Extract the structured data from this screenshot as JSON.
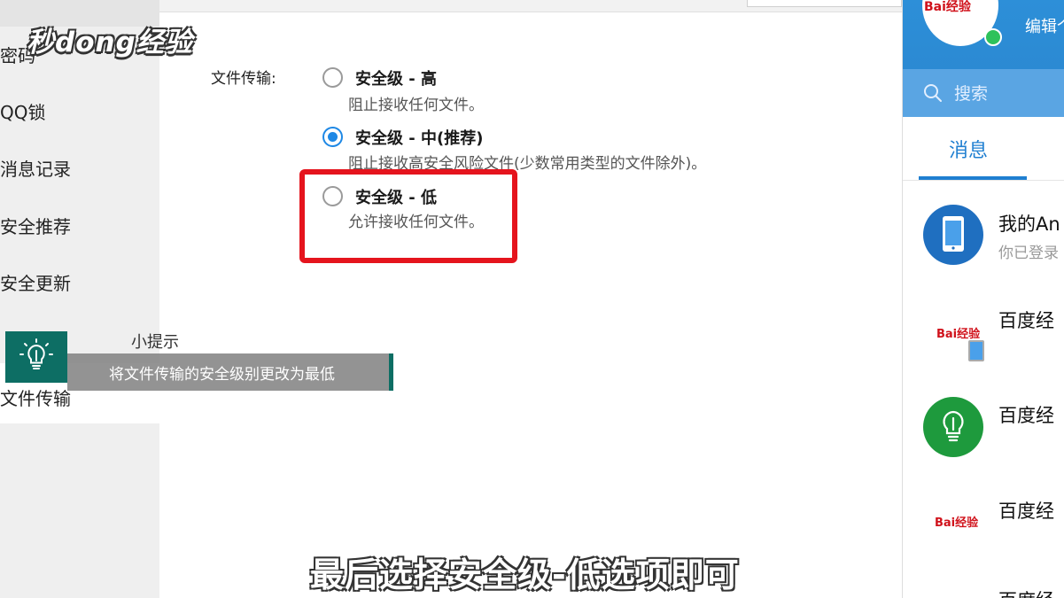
{
  "watermark": {
    "logo": "秒dong经验"
  },
  "sidebar": {
    "items": [
      {
        "label": "密码"
      },
      {
        "label": "QQ锁"
      },
      {
        "label": "消息记录"
      },
      {
        "label": "安全推荐"
      },
      {
        "label": "安全更新"
      },
      {
        "label": "文件传输"
      }
    ]
  },
  "file_transfer": {
    "label": "文件传输:",
    "options": [
      {
        "title": "安全级 - 高",
        "desc": "阻止接收任何文件。",
        "selected": false
      },
      {
        "title": "安全级 - 中(推荐)",
        "desc": "阻止接收高安全风险文件(少数常用类型的文件除外)。",
        "selected": true
      },
      {
        "title": "安全级 - 低",
        "desc": "允许接收任何文件。",
        "selected": false
      }
    ]
  },
  "tip": {
    "title": "小提示",
    "text": "将文件传输的安全级别更改为最低"
  },
  "subtitle": "最后选择安全级-低选项即可",
  "right_panel": {
    "avatar_brand": "Bai经验",
    "edit_label": "编辑个",
    "search_placeholder": "搜索",
    "tab_label": "消息",
    "items": [
      {
        "title": "我的An",
        "sub": "你已登录"
      },
      {
        "title": "百度经",
        "logo": "Bai经验"
      },
      {
        "title": "百度经"
      },
      {
        "title": "百度经",
        "logo": "Bai经验"
      },
      {
        "title": "百度经"
      }
    ]
  },
  "colors": {
    "accent": "#1e88e5",
    "highlight": "#e5141d",
    "tip_teal": "#0d6e64",
    "panel_blue": "#2d8fd8"
  }
}
